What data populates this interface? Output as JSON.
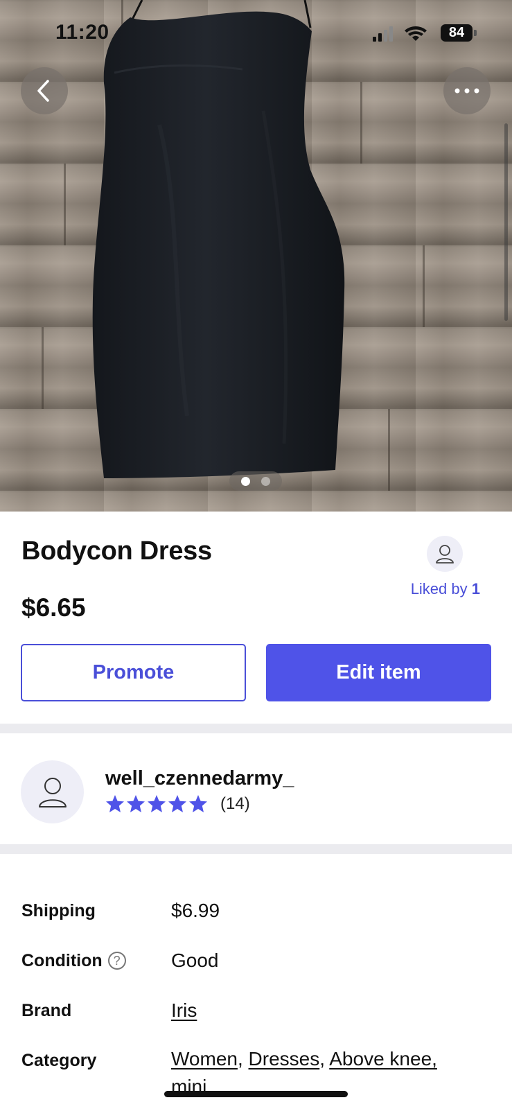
{
  "status_bar": {
    "time": "11:20",
    "battery": "84"
  },
  "gallery": {
    "photo_count": 2,
    "active_photo": 1
  },
  "item": {
    "title": "Bodycon Dress",
    "price": "$6.65",
    "liked_by_prefix": "Liked by ",
    "liked_by_count": "1"
  },
  "actions": {
    "promote_label": "Promote",
    "edit_label": "Edit item"
  },
  "seller": {
    "username": "well_czennedarmy_",
    "rating_stars": 5,
    "review_count": "(14)"
  },
  "details": {
    "shipping_label": "Shipping",
    "shipping_value": "$6.99",
    "condition_label": "Condition",
    "condition_help": "?",
    "condition_value": "Good",
    "brand_label": "Brand",
    "brand_value": "Iris",
    "category_label": "Category",
    "category_values": [
      "Women",
      "Dresses",
      "Above knee, mini"
    ]
  },
  "colors": {
    "accent": "#4f53e8",
    "accent_text": "#4a4fd8",
    "divider": "#ebebef",
    "avatar_bg": "#eeeef7"
  }
}
